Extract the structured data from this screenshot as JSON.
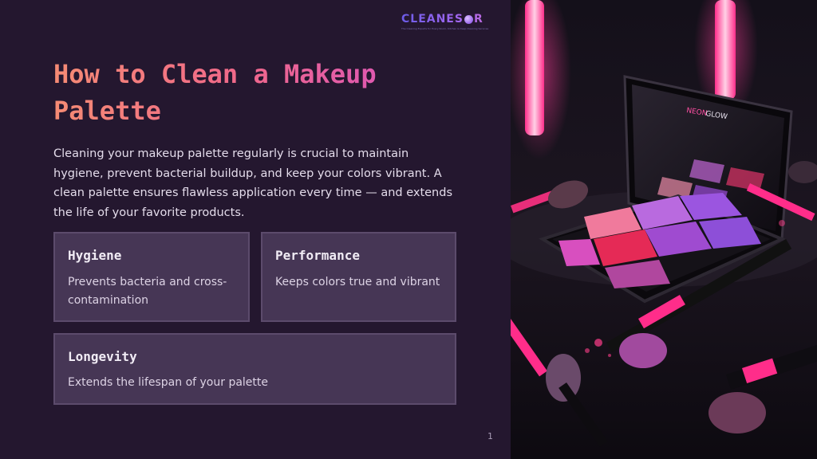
{
  "brand": {
    "name_left": "CLEANES",
    "name_right": "R",
    "tagline": "The Cleaning Experts for Every Room, Kitchen & Deep Cleaning Services"
  },
  "slide": {
    "title": "How to Clean a Makeup Palette",
    "intro": "Cleaning your makeup palette regularly is crucial to maintain hygiene, prevent bacterial buildup, and keep your colors vibrant. A clean palette ensures flawless application every time — and extends the life of your favorite products.",
    "cards": [
      {
        "title": "Hygiene",
        "text": "Prevents bacteria and cross-contamination"
      },
      {
        "title": "Performance",
        "text": "Keeps colors true and vibrant"
      },
      {
        "title": "Longevity",
        "text": "Extends the lifespan of your palette"
      }
    ],
    "page_number": "1"
  },
  "photo": {
    "palette_brand_left": "NEON",
    "palette_brand_right": "GLOW"
  },
  "colors": {
    "background": "#24172f",
    "card": "#463655",
    "title_gradient": [
      "#f58b74",
      "#f0688a",
      "#d44fc9"
    ],
    "neon": "#ff2d8a"
  }
}
